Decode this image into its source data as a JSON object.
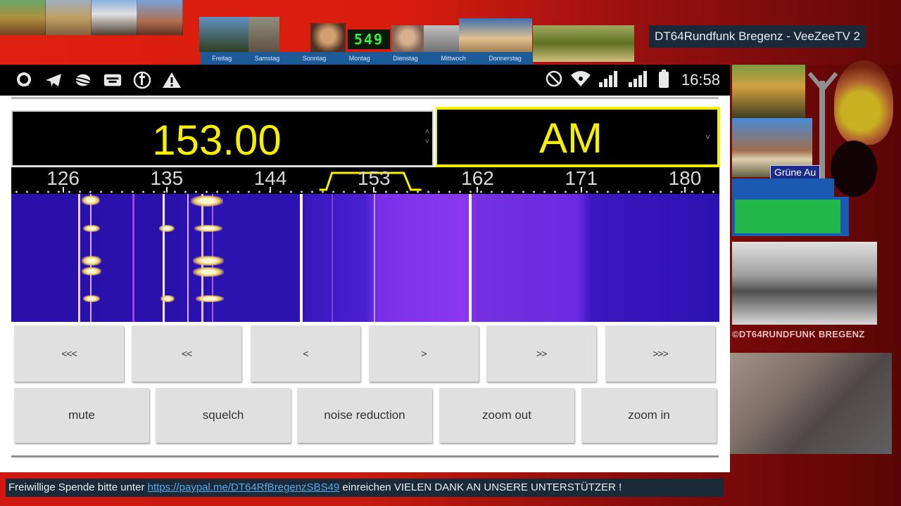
{
  "stream": {
    "channel_title": "DT64Rundfunk Bregenz - VeeZeeTV 2",
    "counter": "549",
    "weekdays": [
      "Freitag",
      "Samstag",
      "Sonntag",
      "Montag",
      "Dienstag",
      "Mittwoch",
      "Donnerstag"
    ],
    "side_label_gruene_au": "Grüne Au",
    "side_label_station": "©DT64RUNDFUNK BREGENZ",
    "ticker": {
      "prefix": "Freiwillige Spende bitte unter ",
      "link": "https://paypal.me/DT64RfBregenzSBS49",
      "suffix": " einreichen VIELEN  DANK AN UNSERE UNTERSTÜTZER !"
    }
  },
  "statusbar": {
    "left_icons": [
      "chat-bubble-icon",
      "telegram-icon",
      "planet-icon",
      "media-icon",
      "facebook-icon",
      "warning-icon"
    ],
    "right_icons": [
      "do-not-disturb-icon",
      "wifi-icon",
      "signal-icon",
      "signal-icon-2",
      "battery-icon"
    ],
    "time": "16:58"
  },
  "radio": {
    "frequency": "153.00",
    "mode": "AM",
    "accent_color": "#f5f000",
    "scale": {
      "unit_hint": "kHz",
      "ticks": [
        "126",
        "135",
        "144",
        "153",
        "162",
        "171",
        "180"
      ],
      "range": [
        121.5,
        183.0
      ],
      "passband": [
        148.5,
        157.5
      ]
    },
    "tuning_buttons": [
      "<<<",
      "<<",
      "<",
      ">",
      ">>",
      ">>>"
    ],
    "function_buttons": [
      "mute",
      "squelch",
      "noise reduction",
      "zoom out",
      "zoom in"
    ]
  }
}
